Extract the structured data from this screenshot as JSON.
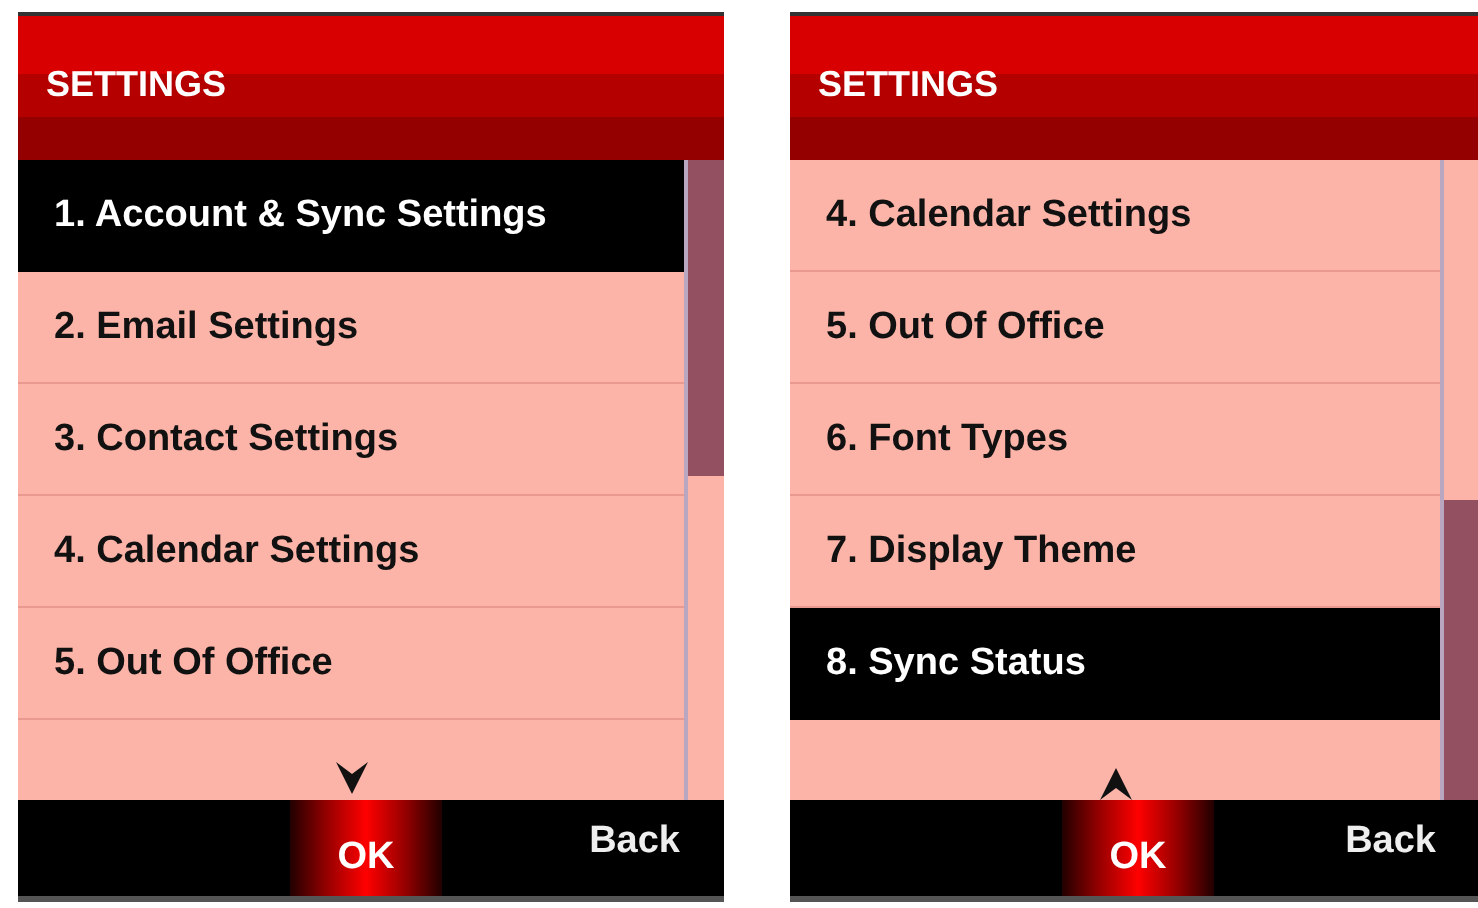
{
  "screens": [
    {
      "title": "SETTINGS",
      "scrolled_to_end": false,
      "items": [
        {
          "label": "1. Account & Sync Settings",
          "selected": true
        },
        {
          "label": "2. Email Settings",
          "selected": false
        },
        {
          "label": "3. Contact Settings",
          "selected": false
        },
        {
          "label": "4. Calendar Settings",
          "selected": false
        },
        {
          "label": "5. Out Of Office",
          "selected": false
        }
      ],
      "softkeys": {
        "ok": "OK",
        "back": "Back"
      }
    },
    {
      "title": "SETTINGS",
      "scrolled_to_end": true,
      "items": [
        {
          "label": "4. Calendar Settings",
          "selected": false
        },
        {
          "label": "5. Out Of Office",
          "selected": false
        },
        {
          "label": "6. Font Types",
          "selected": false
        },
        {
          "label": "7. Display Theme",
          "selected": false
        },
        {
          "label": "8. Sync Status",
          "selected": true
        }
      ],
      "softkeys": {
        "ok": "OK",
        "back": "Back"
      }
    }
  ]
}
